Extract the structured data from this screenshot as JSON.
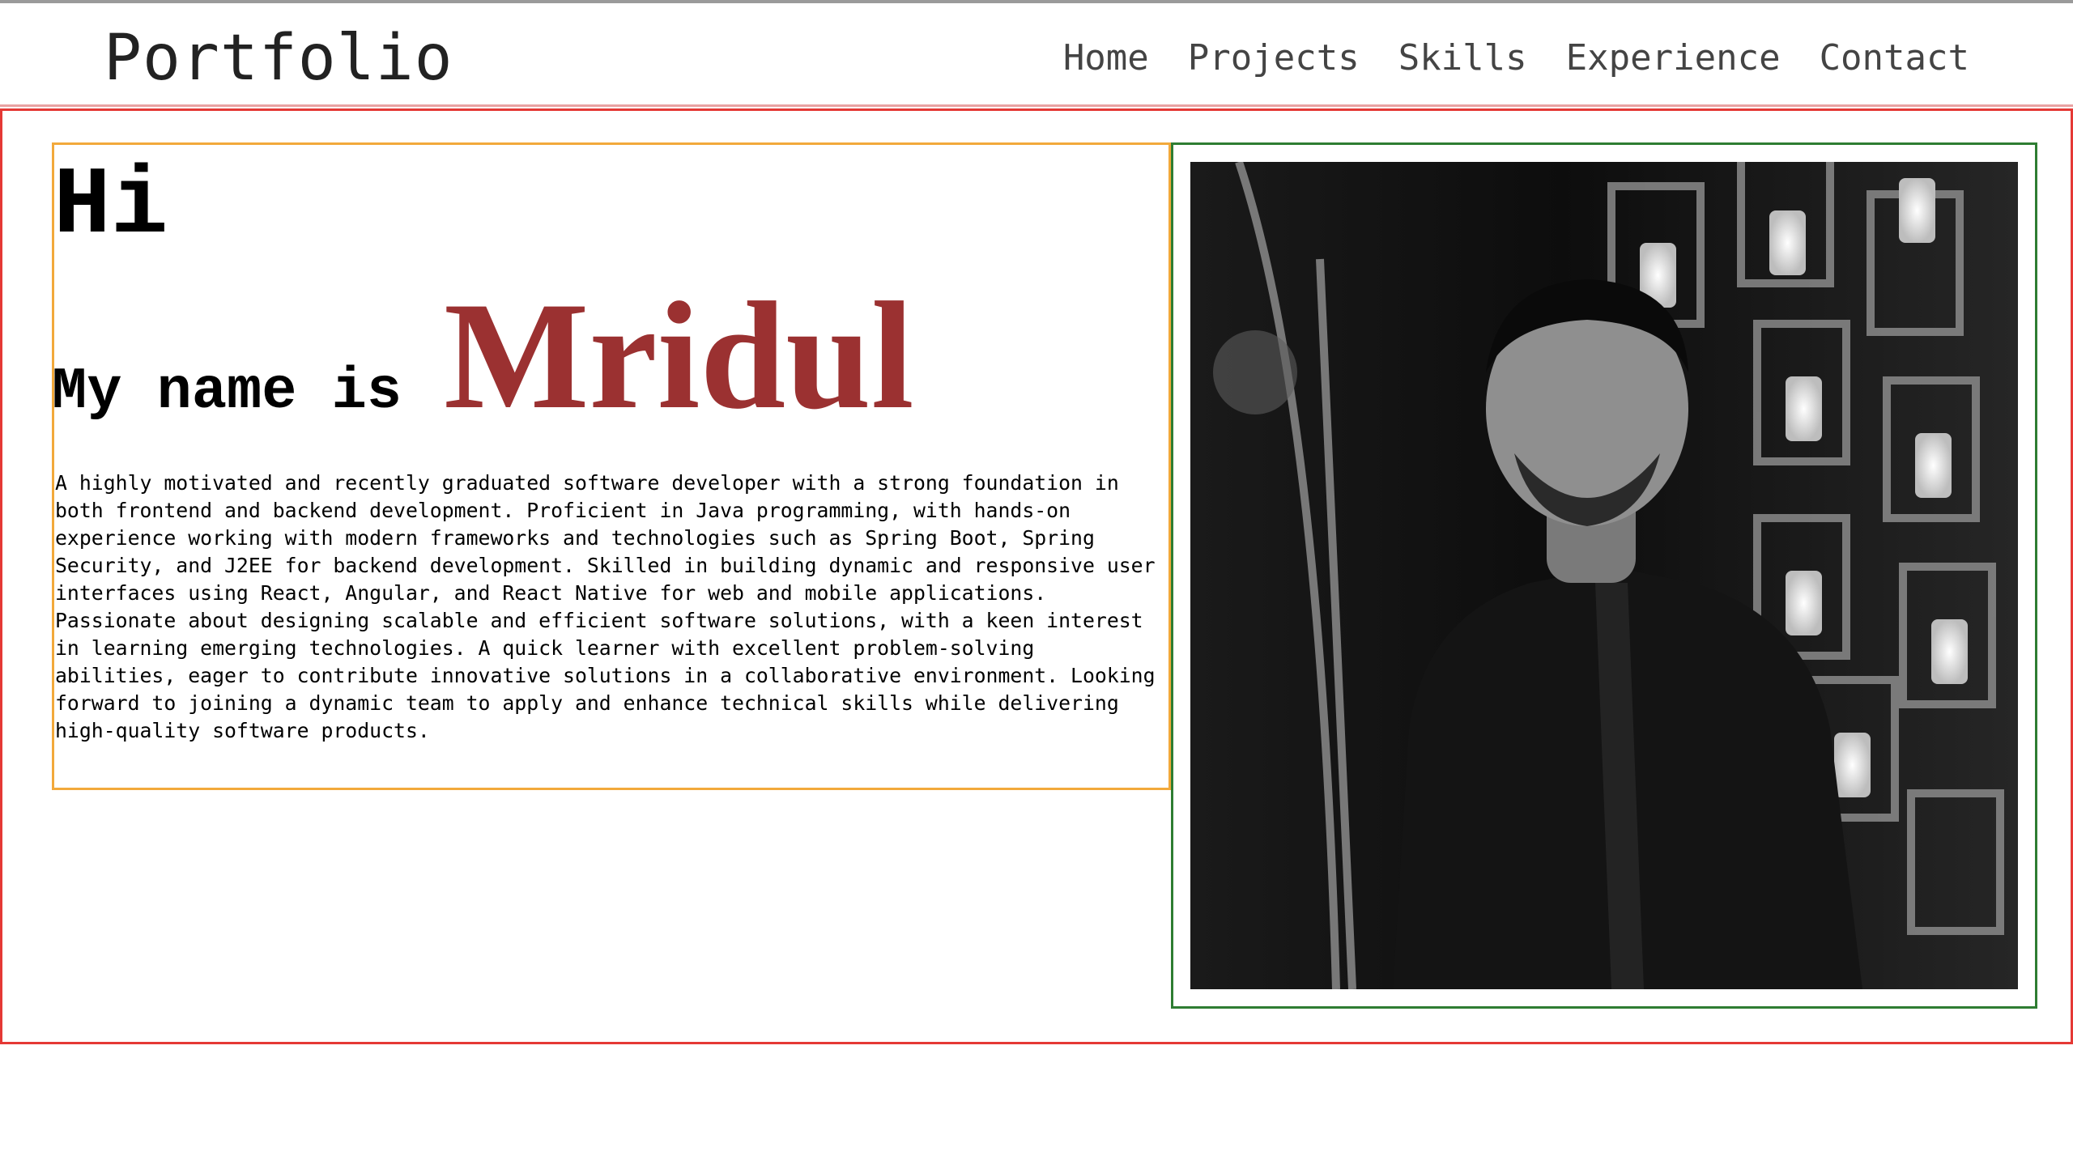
{
  "header": {
    "brand": "Portfolio",
    "nav": [
      {
        "label": "Home"
      },
      {
        "label": "Projects"
      },
      {
        "label": "Skills"
      },
      {
        "label": "Experience"
      },
      {
        "label": "Contact"
      }
    ]
  },
  "hero": {
    "greeting": "Hi",
    "name_prefix": "My name is",
    "name": "Mridul",
    "bio": "A highly motivated and recently graduated software developer with a strong foundation in both frontend and backend development. Proficient in Java programming, with hands-on experience working with modern frameworks and technologies such as Spring Boot, Spring Security, and J2EE for backend development. Skilled in building dynamic and responsive user interfaces using React, Angular, and React Native for web and mobile applications. Passionate about designing scalable and efficient software solutions, with a keen interest in learning emerging technologies. A quick learner with excellent problem-solving abilities, eager to contribute innovative solutions in a collaborative environment. Looking forward to joining a dynamic team to apply and enhance technical skills while delivering high-quality software products."
  },
  "colors": {
    "name_accent": "#9b3131",
    "main_border": "#e53935",
    "intro_border": "#f2a93b",
    "photo_border": "#2e7d32"
  }
}
